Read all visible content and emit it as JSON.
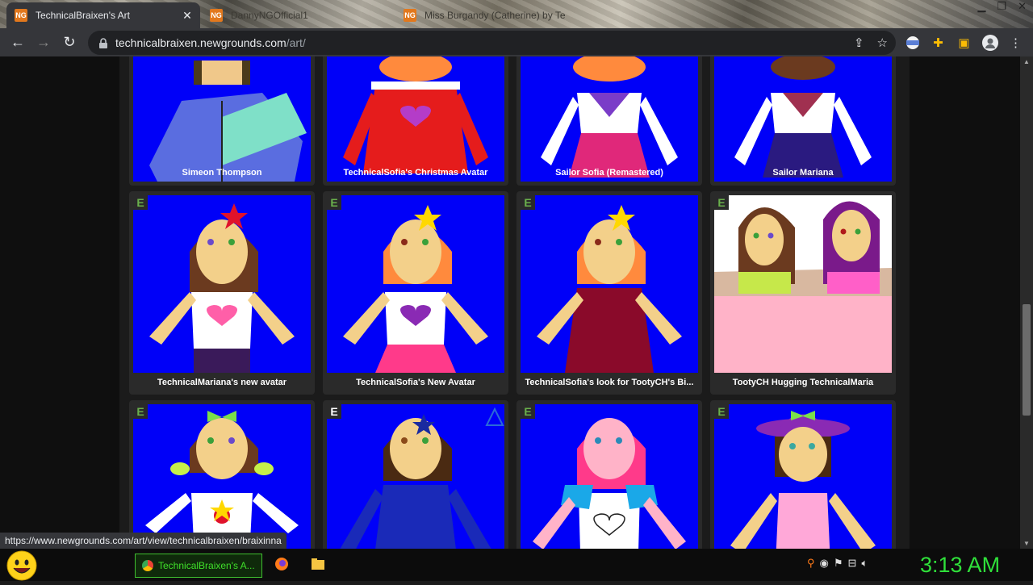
{
  "browser": {
    "tabs": [
      {
        "title": "TechnicalBraixen's Art",
        "active": true
      },
      {
        "title": "DannyNGOfficial1",
        "active": false
      },
      {
        "title": "Miss Burgandy (Catherine) by Te",
        "active": false
      }
    ],
    "close_tab_symbol": "✕",
    "url_domain": "technicalbraixen.newgrounds.com",
    "url_path": "/art/",
    "status_url": "https://www.newgrounds.com/art/view/technicalbraixen/braixinna"
  },
  "gallery": {
    "rating_label": "E",
    "items": [
      {
        "title": "Simeon Thompson"
      },
      {
        "title": "TechnicalSofia's Christmas Avatar"
      },
      {
        "title": "Sailor Sofia (Remastered)"
      },
      {
        "title": "Sailor Mariana"
      },
      {
        "title": "TechnicalMariana's new avatar"
      },
      {
        "title": "TechnicalSofia's New Avatar"
      },
      {
        "title": "TechnicalSofia's look for TootyCH's Bi..."
      },
      {
        "title": "TootyCH Hugging TechnicalMaria"
      },
      {
        "title": ""
      },
      {
        "title": ""
      },
      {
        "title": ""
      },
      {
        "title": ""
      }
    ]
  },
  "taskbar": {
    "active_window": "TechnicalBraixen's A...",
    "clock": "3:13 AM"
  },
  "colors": {
    "accent_green": "#3fe02a",
    "thumb_blue": "#0000f8",
    "rating_green": "#6ab04c"
  }
}
